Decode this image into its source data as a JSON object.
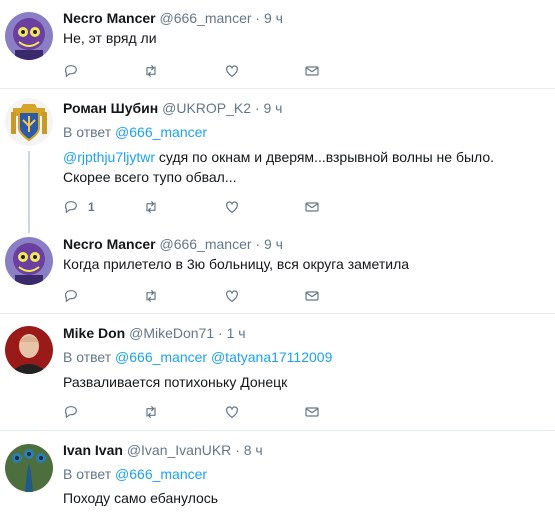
{
  "tweets": [
    {
      "name": "Necro Mancer",
      "handle": "@666_mancer",
      "dot": "·",
      "time": "9 ч",
      "reply_prefix": "",
      "reply_to": [],
      "text": "Не, эт вряд ли",
      "replies": "",
      "avatar": "creature-avatar"
    },
    {
      "name": "Роман Шубин",
      "handle": "@UKROP_K2",
      "dot": "·",
      "time": "9 ч",
      "reply_prefix": "В ответ",
      "reply_to": [
        "@666_mancer"
      ],
      "text_mention": "@rjpthju7ljytwr",
      "text": " судя по окнам и дверям...взрывной волны не было. Скорее всего тупо обвал...",
      "replies": "1",
      "avatar": "coat-of-arms-avatar"
    },
    {
      "name": "Necro Mancer",
      "handle": "@666_mancer",
      "dot": "·",
      "time": "9 ч",
      "reply_prefix": "",
      "reply_to": [],
      "text": "Когда прилетело в 3ю больницу, вся округа заметила",
      "replies": "",
      "avatar": "creature-avatar"
    },
    {
      "name": "Mike Don",
      "handle": "@MikeDon71",
      "dot": "·",
      "time": "1 ч",
      "reply_prefix": "В ответ",
      "reply_to": [
        "@666_mancer",
        "@tatyana17112009"
      ],
      "text": "Разваливается потихоньку Донецк",
      "replies": "",
      "avatar": "person-avatar"
    },
    {
      "name": "Ivan Ivan",
      "handle": "@Ivan_IvanUKR",
      "dot": "·",
      "time": "8 ч",
      "reply_prefix": "В ответ",
      "reply_to": [
        "@666_mancer"
      ],
      "text": "Походу само ебанулось",
      "replies": "",
      "avatar": "peacock-avatar"
    }
  ],
  "icons": {
    "reply": "reply-icon",
    "retweet": "retweet-icon",
    "like": "heart-icon",
    "dm": "envelope-icon"
  },
  "colors": {
    "link": "#1da1f2",
    "secondary": "#657786",
    "separator": "#e6ecf0",
    "thread_line": "#ccd6dd"
  }
}
